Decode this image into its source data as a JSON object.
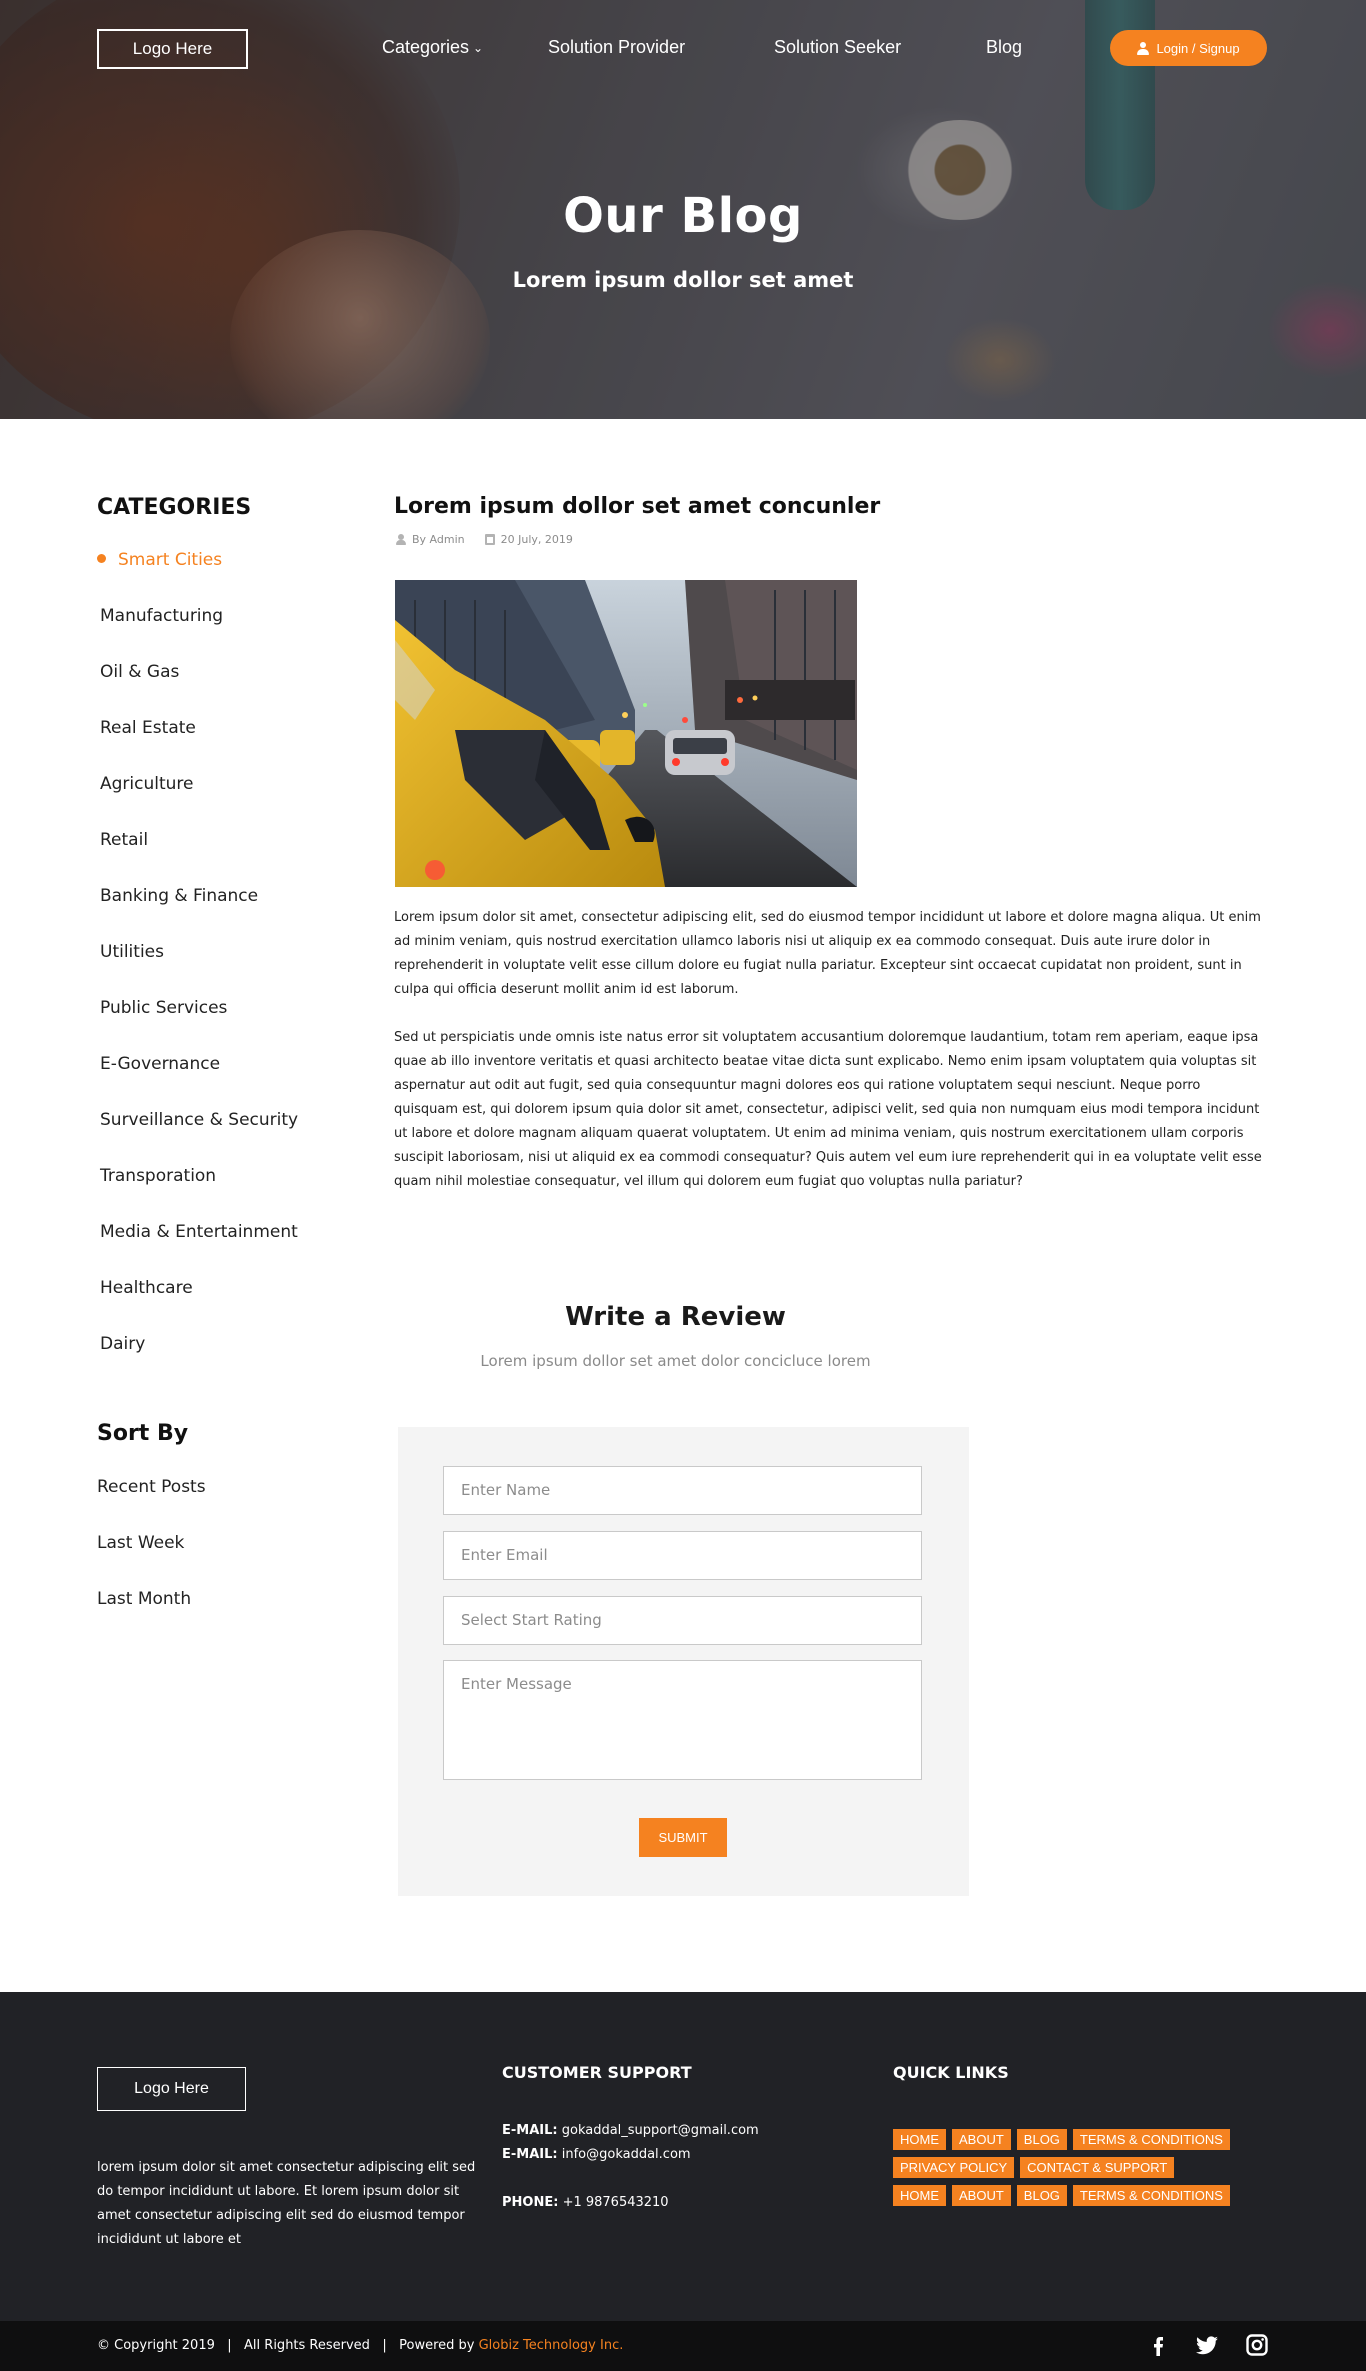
{
  "header": {
    "logo": "Logo Here",
    "nav": {
      "categories": "Categories",
      "solution_provider": "Solution Provider",
      "solution_seeker": "Solution Seeker",
      "blog": "Blog"
    },
    "login_label": "Login / Signup",
    "title": "Our Blog",
    "subtitle": "Lorem ipsum dollor set amet"
  },
  "sidebar": {
    "categories_heading": "CATEGORIES",
    "categories": [
      "Smart Cities",
      "Manufacturing",
      "Oil & Gas",
      "Real Estate",
      "Agriculture",
      "Retail",
      "Banking & Finance",
      "Utilities",
      "Public Services",
      "E-Governance",
      "Surveillance & Security",
      "Transporation",
      "Media & Entertainment",
      "Healthcare",
      "Dairy"
    ],
    "active_category": "Smart Cities",
    "sort_heading": "Sort By",
    "sort_options": [
      "Recent Posts",
      "Last Week",
      "Last Month"
    ]
  },
  "post": {
    "title": "Lorem ipsum dollor set amet concunler",
    "author": "By Admin",
    "date": "20 July, 2019",
    "paragraphs": [
      "Lorem ipsum dolor sit amet, consectetur adipiscing elit, sed do eiusmod tempor incididunt ut labore et dolore magna aliqua. Ut enim ad minim veniam, quis nostrud exercitation ullamco laboris nisi ut aliquip ex ea commodo consequat. Duis aute irure dolor in reprehenderit in voluptate velit esse cillum dolore eu fugiat nulla pariatur. Excepteur sint occaecat cupidatat non proident, sunt in culpa qui officia deserunt mollit anim id est laborum.",
      "Sed ut perspiciatis unde omnis iste natus error sit voluptatem accusantium doloremque laudantium, totam rem aperiam, eaque ipsa quae ab illo inventore veritatis et quasi architecto beatae vitae dicta sunt explicabo. Nemo enim ipsam voluptatem quia voluptas sit aspernatur aut odit aut fugit, sed quia consequuntur magni dolores eos qui ratione voluptatem sequi nesciunt. Neque porro quisquam est, qui dolorem ipsum quia dolor sit amet, consectetur, adipisci velit, sed quia non numquam eius modi tempora incidunt ut labore et dolore magnam aliquam quaerat voluptatem. Ut enim ad minima veniam, quis nostrum exercitationem ullam corporis suscipit laboriosam, nisi ut aliquid ex ea commodi consequatur? Quis autem vel eum iure reprehenderit qui in ea voluptate velit esse quam nihil molestiae consequatur, vel illum qui dolorem eum fugiat quo voluptas nulla pariatur?"
    ]
  },
  "review": {
    "title": "Write a Review",
    "subtitle": "Lorem ipsum dollor set amet dolor concicluce lorem",
    "name_placeholder": "Enter Name",
    "email_placeholder": "Enter Email",
    "rating_placeholder": "Select Start Rating",
    "message_placeholder": "Enter Message",
    "submit_label": "SUBMIT"
  },
  "footer": {
    "logo": "Logo Here",
    "about": "lorem ipsum dolor sit amet consectetur adipiscing elit sed do tempor incididunt ut labore.  Et lorem ipsum dolor sit amet consectetur adipiscing elit sed do eiusmod tempor incididunt ut labore et",
    "support_heading": "CUSTOMER SUPPORT",
    "email_label": "E-MAIL:",
    "email_1": "gokaddal_support@gmail.com",
    "email_2": "info@gokaddal.com",
    "phone_label": "PHONE:",
    "phone": "+1 9876543210",
    "quick_links_heading": "QUICK LINKS",
    "quick_links_row1": [
      "HOME",
      "ABOUT",
      "BLOG",
      "TERMS & CONDITIONS"
    ],
    "quick_links_row2": [
      "PRIVACY POLICY",
      "CONTACT & SUPPORT"
    ],
    "quick_links_row3": [
      "HOME",
      "ABOUT",
      "BLOG",
      "TERMS & CONDITIONS"
    ],
    "copyright": "© Copyright 2019   |   All Rights Reserved   |   Powered by ",
    "powered_by": "Globiz Technology Inc.",
    "social_icons": [
      "facebook-icon",
      "twitter-icon",
      "instagram-icon"
    ]
  },
  "colors": {
    "accent": "#f58220",
    "footer_bg": "#212226",
    "bottom_bar_bg": "#0f0f10",
    "form_bg": "#f4f4f4"
  }
}
